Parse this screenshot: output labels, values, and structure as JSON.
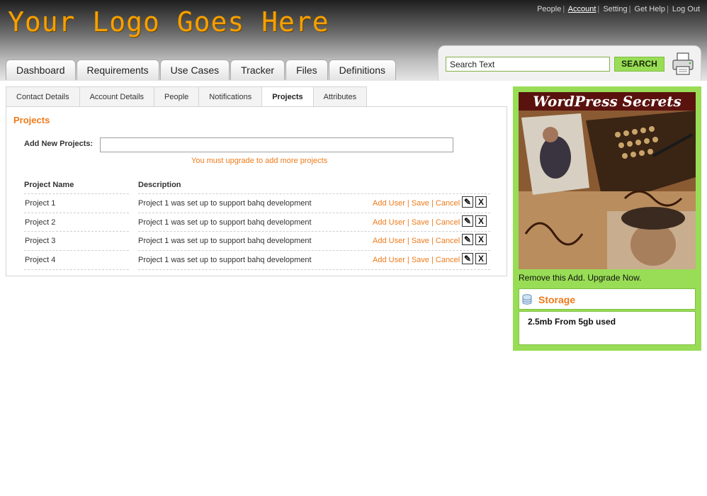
{
  "header": {
    "logo_text": "Your Logo Goes Here",
    "top_links": [
      {
        "label": "People"
      },
      {
        "label": "Account",
        "active": true
      },
      {
        "label": "Setting"
      },
      {
        "label": "Get Help"
      },
      {
        "label": "Log Out"
      }
    ],
    "tabs": [
      {
        "label": "Dashboard"
      },
      {
        "label": "Requirements"
      },
      {
        "label": "Use Cases"
      },
      {
        "label": "Tracker"
      },
      {
        "label": "Files"
      },
      {
        "label": "Definitions"
      }
    ],
    "search": {
      "value": "Search Text",
      "button_label": "SEARCH"
    },
    "print_icon": "printer-icon"
  },
  "subtabs": [
    {
      "label": "Contact Details"
    },
    {
      "label": "Account Details"
    },
    {
      "label": "People"
    },
    {
      "label": "Notifications"
    },
    {
      "label": "Projects",
      "active": true
    },
    {
      "label": "Attributes"
    }
  ],
  "projects": {
    "title": "Projects",
    "add_label": "Add New Projects:",
    "add_value": "",
    "upgrade_note": "You must upgrade to add more projects",
    "col_name": "Project Name",
    "col_desc": "Description",
    "rows": [
      {
        "name": "Project 1",
        "description": "Project 1 was set up to support bahq development"
      },
      {
        "name": "Project 2",
        "description": "Project 1 was set up to support bahq development"
      },
      {
        "name": "Project 3",
        "description": "Project 1 was set up to support bahq development"
      },
      {
        "name": "Project 4",
        "description": "Project 1 was set up to support bahq development"
      }
    ],
    "actions": {
      "add_user": "Add User",
      "save": "Save",
      "cancel": "Cancel",
      "separator": "|"
    },
    "edit_icon": "pencil-icon",
    "delete_icon": "close-icon"
  },
  "sidebar": {
    "ad_title": "WordPress Secrets",
    "ad_text": "Remove this Add. Upgrade Now.",
    "storage_title": "Storage",
    "storage_usage": "2.5mb From 5gb used",
    "storage_icon": "database-icon"
  },
  "colors": {
    "accent_orange": "#ee7a1a",
    "logo_orange": "#f6a000",
    "sidebar_green": "#98dd55"
  }
}
